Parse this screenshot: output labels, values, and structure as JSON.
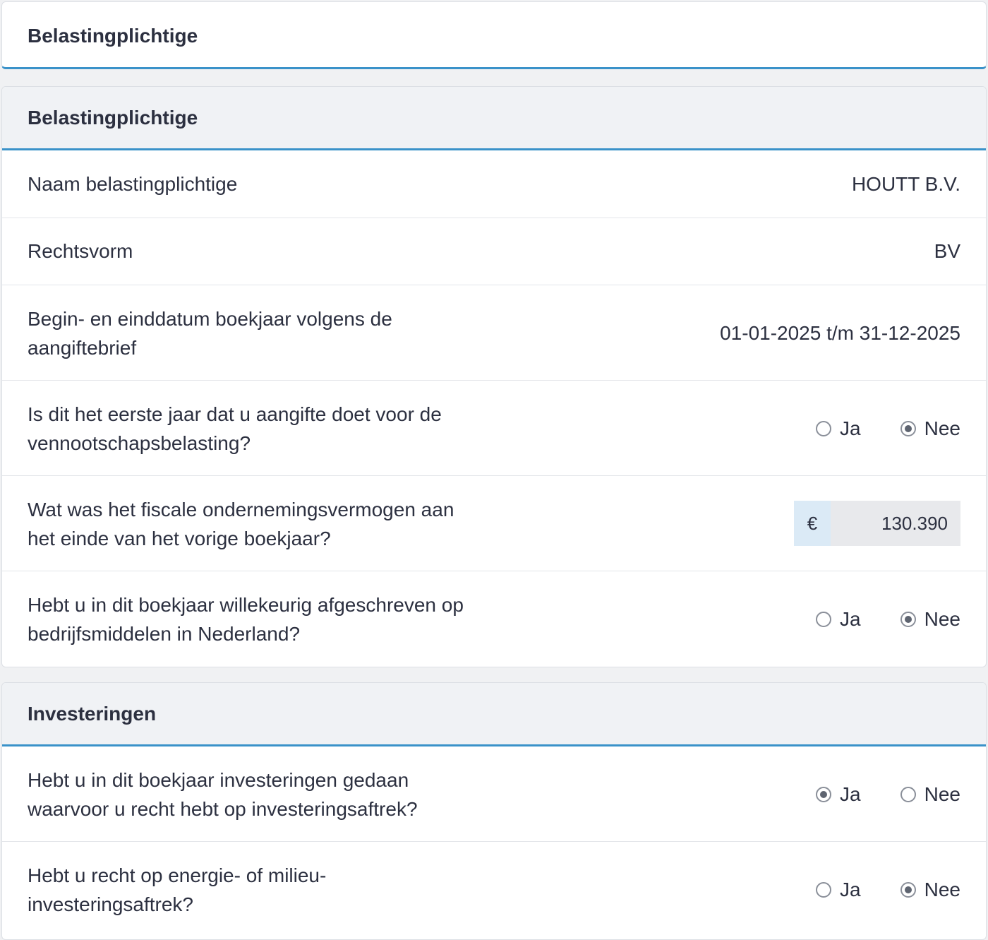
{
  "top": {
    "title": "Belastingplichtige"
  },
  "belastingplichtige": {
    "title": "Belastingplichtige",
    "naam": {
      "label": "Naam belastingplichtige",
      "value": "HOUTT B.V."
    },
    "rechtsvorm": {
      "label": "Rechtsvorm",
      "value": "BV"
    },
    "boekjaar": {
      "label": "Begin- en einddatum boekjaar volgens de aangiftebrief",
      "value": "01-01-2025 t/m 31-12-2025"
    },
    "eerste_jaar": {
      "label": "Is dit het eerste jaar dat u aangifte doet voor de vennootschapsbelasting?",
      "ja": "Ja",
      "nee": "Nee",
      "selected": "Nee"
    },
    "vermogen": {
      "label": "Wat was het fiscale ondernemingsvermogen aan het einde van het vorige boekjaar?",
      "currency": "€",
      "value": "130.390"
    },
    "willekeurig": {
      "label": "Hebt u in dit boekjaar willekeurig afgeschreven op bedrijfsmiddelen in Nederland?",
      "ja": "Ja",
      "nee": "Nee",
      "selected": "Nee"
    }
  },
  "investeringen": {
    "title": "Investeringen",
    "investeringsaftrek": {
      "label": "Hebt u in dit boekjaar investeringen gedaan waarvoor u recht hebt op investeringsaftrek?",
      "ja": "Ja",
      "nee": "Nee",
      "selected": "Ja"
    },
    "energie": {
      "label": "Hebt u recht op energie- of milieu-investeringsaftrek?",
      "ja": "Ja",
      "nee": "Nee",
      "selected": "Nee"
    }
  },
  "colors": {
    "accent": "#3a92c9",
    "header_bg": "#f0f2f5",
    "currency_bg": "#dbeaf6"
  }
}
